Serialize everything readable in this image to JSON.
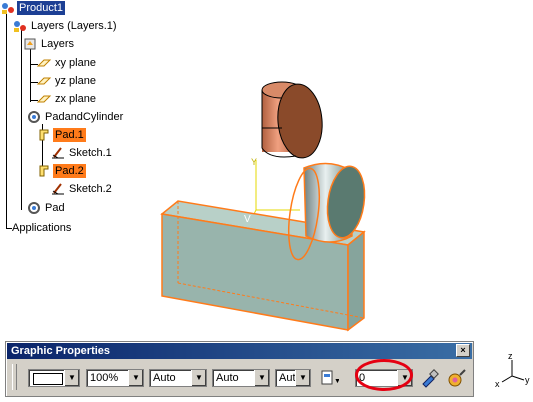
{
  "tree": {
    "root": "Product1",
    "layers_root": "Layers (Layers.1)",
    "layers": "Layers",
    "planes": [
      "xy plane",
      "yz plane",
      "zx plane"
    ],
    "pad_and_cylinder": "PadandCylinder",
    "pad1": "Pad.1",
    "sketch1": "Sketch.1",
    "pad2": "Pad.2",
    "sketch2": "Sketch.2",
    "pad": "Pad",
    "applications": "Applications"
  },
  "viewport": {
    "axis_label": "V"
  },
  "toolbar": {
    "title": "Graphic Properties",
    "close": "×",
    "color_value": "",
    "transparency_value": "100%",
    "line_thickness_value": "Auto",
    "line_type_value": "Auto",
    "point_symbol_value": "Aut",
    "layer_value": "0"
  },
  "compass": {
    "x": "x",
    "y": "y",
    "z": "z"
  },
  "colors": {
    "tree_selection": "#1c3f94",
    "pad_highlight": "#ff7b1a",
    "title_bar": "#0a246a",
    "annotation_ring": "#e50012"
  }
}
